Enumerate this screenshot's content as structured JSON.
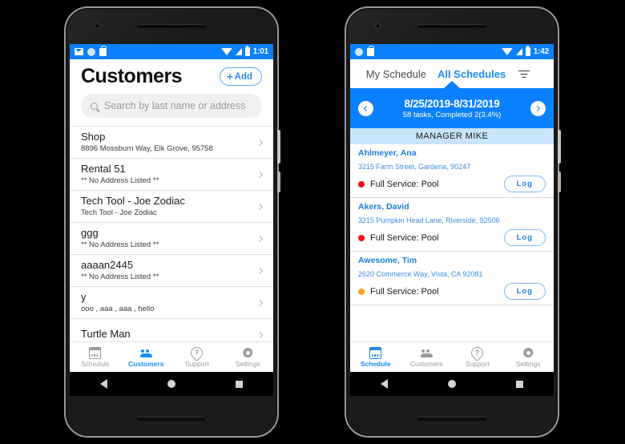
{
  "phones": {
    "left": {
      "status_bar": {
        "time": "1:01",
        "left_icons": [
          "gmail-icon",
          "circle-icon",
          "shopping-bag-icon"
        ],
        "right_icons": [
          "wifi-icon",
          "signal-icon",
          "battery-icon"
        ]
      },
      "header": {
        "title": "Customers",
        "add_label": "Add",
        "add_plus": "+"
      },
      "search": {
        "placeholder": "Search by last name or address"
      },
      "customers": [
        {
          "name": "Shop",
          "address": "8896 Mossburn Way, Elk Grove, 95758"
        },
        {
          "name": "Rental 51",
          "address": "** No Address Listed **"
        },
        {
          "name": "Tech Tool - Joe Zodiac",
          "address": "Tech Tool - Joe Zodiac"
        },
        {
          "name": "ggg",
          "address": "** No Address Listed **"
        },
        {
          "name": "aaaan2445",
          "address": "** No Address Listed **"
        },
        {
          "name": "y",
          "address": "ooo , aaa , aaa , hello"
        },
        {
          "name": "Turtle Man",
          "address": ""
        }
      ],
      "tabs": [
        {
          "label": "Schedule",
          "icon": "calendar-icon",
          "active": false
        },
        {
          "label": "Customers",
          "icon": "people-icon",
          "active": true
        },
        {
          "label": "Support",
          "icon": "help-icon",
          "active": false
        },
        {
          "label": "Settings",
          "icon": "gear-icon",
          "active": false
        }
      ]
    },
    "right": {
      "status_bar": {
        "time": "1:42",
        "left_icons": [
          "circle-icon",
          "shopping-bag-icon"
        ],
        "right_icons": [
          "wifi-icon",
          "signal-icon",
          "battery-icon"
        ]
      },
      "segment_tabs": {
        "my_schedule": "My Schedule",
        "all_schedules": "All Schedules",
        "filter_icon": "filter-icon"
      },
      "week_bar": {
        "range": "8/25/2019-8/31/2019",
        "summary": "58 tasks, Completed 2(3.4%)",
        "prev_icon": "chevron-left-icon",
        "next_icon": "chevron-right-icon"
      },
      "manager_header": "MANAGER MIKE",
      "schedule_items": [
        {
          "name": "Ahlmeyer, Ana",
          "address": "3215 Farm Street, Gardena, 90247",
          "service": "Full Service: Pool",
          "status_color": "#ee1111",
          "log_label": "Log"
        },
        {
          "name": "Akers, David",
          "address": "3215 Pumpkin Head Lane, Riverside, 92506",
          "service": "Full Service: Pool",
          "status_color": "#ee1111",
          "log_label": "Log"
        },
        {
          "name": "Awesome, Tim",
          "address": "2620 Commerce Way, Vista, CA 92081",
          "service": "Full Service: Pool",
          "status_color": "#f5a623",
          "log_label": "Log"
        }
      ],
      "tabs": [
        {
          "label": "Schedule",
          "icon": "calendar-icon",
          "active": true
        },
        {
          "label": "Customers",
          "icon": "people-icon",
          "active": false
        },
        {
          "label": "Support",
          "icon": "help-icon",
          "active": false
        },
        {
          "label": "Settings",
          "icon": "gear-icon",
          "active": false
        }
      ]
    }
  },
  "android_nav": {
    "back": "back-icon",
    "home": "home-icon",
    "recents": "recents-icon"
  },
  "colors": {
    "primary_blue": "#0a80ff",
    "link_blue": "#1b7fe0",
    "manager_band": "#c9e3fb",
    "status_red": "#ee1111",
    "status_orange": "#f5a623"
  }
}
